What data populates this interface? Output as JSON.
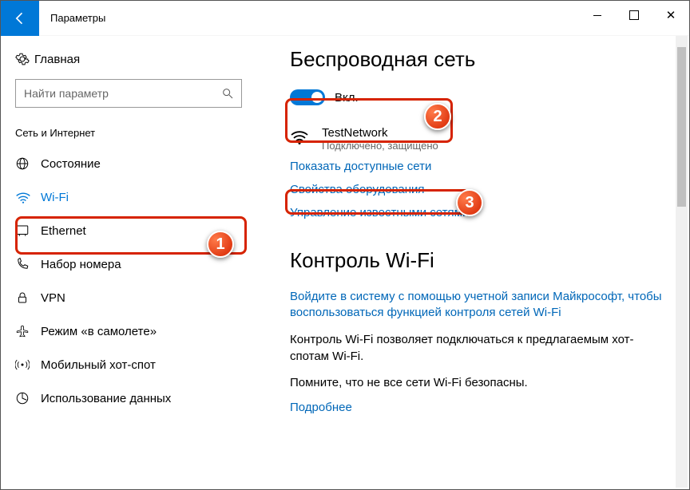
{
  "titlebar": {
    "title": "Параметры"
  },
  "sidebar": {
    "home": "Главная",
    "search_placeholder": "Найти параметр",
    "section": "Сеть и Интернет",
    "items": [
      {
        "label": "Состояние"
      },
      {
        "label": "Wi-Fi"
      },
      {
        "label": "Ethernet"
      },
      {
        "label": "Набор номера"
      },
      {
        "label": "VPN"
      },
      {
        "label": "Режим «в самолете»"
      },
      {
        "label": "Мобильный хот-спот"
      },
      {
        "label": "Использование данных"
      }
    ]
  },
  "main": {
    "heading": "Беспроводная сеть",
    "toggle_label": "Вкл.",
    "network": {
      "name": "TestNetwork",
      "status": "Подключено, защищено"
    },
    "links": {
      "show_networks": "Показать доступные сети",
      "hw_props": "Свойства оборудования",
      "manage": "Управление известными сетями"
    },
    "section2": "Контроль Wi-Fi",
    "signin_link": "Войдите в систему с помощью учетной записи Майкрософт, чтобы воспользоваться функцией контроля сетей Wi-Fi",
    "body1": "Контроль Wi-Fi позволяет подключаться к предлагаемым хот-спотам Wi-Fi.",
    "body2": "Помните, что не все сети Wi-Fi безопасны.",
    "more": "Подробнее"
  },
  "markers": {
    "m1": "1",
    "m2": "2",
    "m3": "3"
  }
}
